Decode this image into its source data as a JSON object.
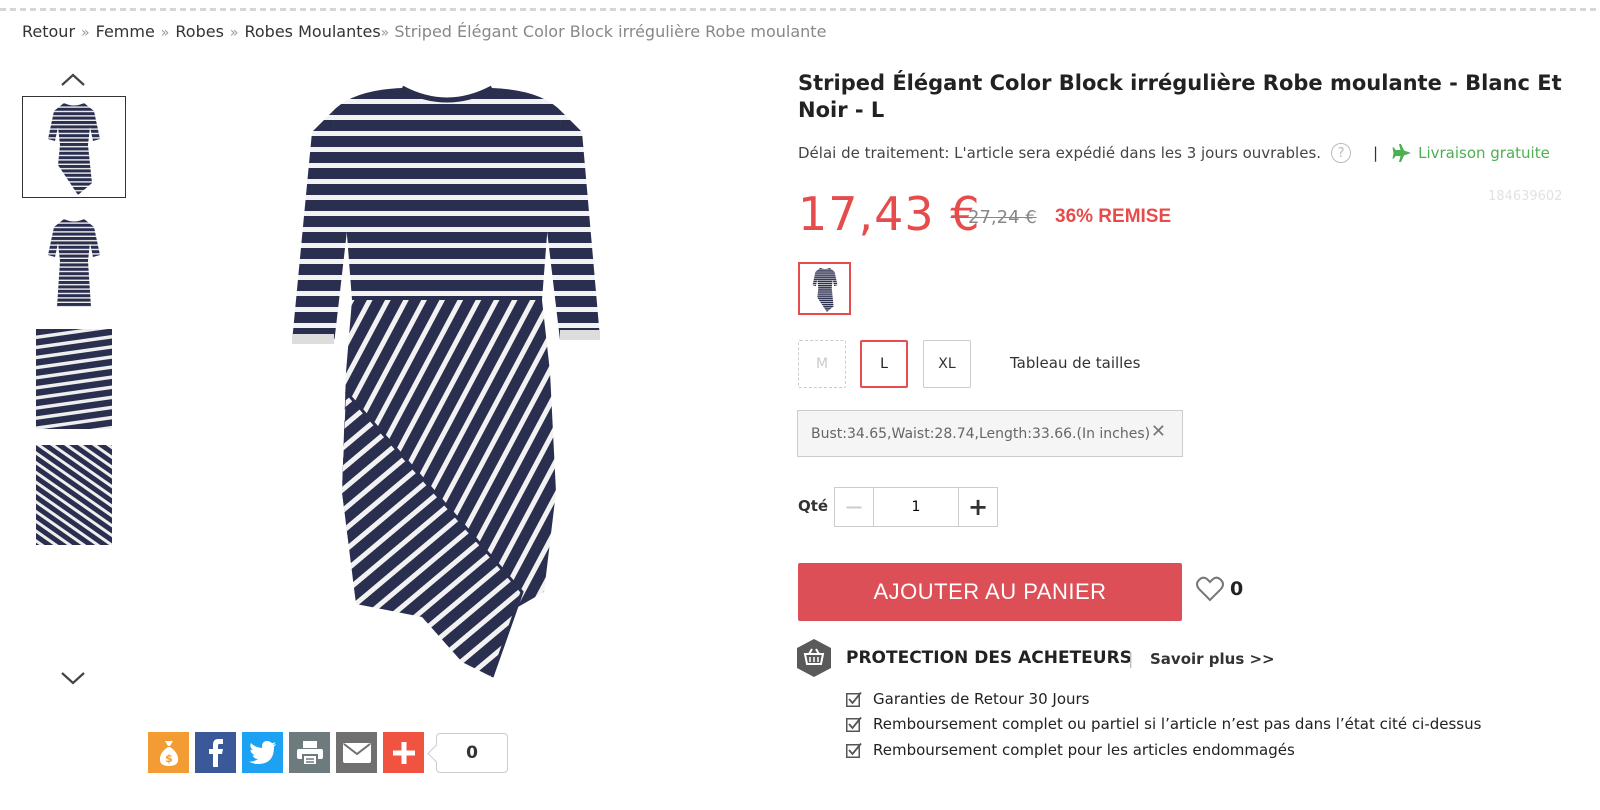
{
  "breadcrumb": {
    "items": [
      "Retour",
      "Femme",
      "Robes",
      "Robes Moulantes"
    ],
    "current": "Striped Élégant Color Block irrégulière Robe moulante"
  },
  "product": {
    "title": "Striped Élégant Color Block irrégulière Robe moulante - Blanc Et Noir - L",
    "delay_text": "Délai de traitement: L'article sera expédié dans les 3 jours ouvrables.",
    "help_glyph": "?",
    "divider": "|",
    "shipping": "Livraison gratuite",
    "sku": "184639602",
    "price": "17,43 €",
    "old_price": "27,24 €",
    "discount": "36% REMISE"
  },
  "sizes": {
    "options": [
      "M",
      "L",
      "XL"
    ],
    "selected": "L",
    "unavailable": [
      "M"
    ],
    "chart_label": "Tableau de tailles",
    "measure": "Bust:34.65,Waist:28.74,Length:33.66.(In inches)",
    "close_glyph": "✕"
  },
  "quantity": {
    "label": "Qté",
    "value": "1",
    "minus": "−",
    "plus": "+"
  },
  "cart": {
    "add_label": "AJOUTER AU PANIER",
    "wish_count": "0"
  },
  "protection": {
    "title": "PROTECTION DES ACHETEURS",
    "sep": "|",
    "more": "Savoir plus >>",
    "items": [
      "Garanties de Retour 30 Jours",
      "Remboursement complet ou partiel si l’article n’est pas dans l’état cité ci-dessus",
      "Remboursement complet pour les articles endommagés"
    ]
  },
  "share": {
    "count": "0"
  },
  "colors": {
    "accent": "#e64c4c",
    "cart": "#dd4f57",
    "shipping": "#4caf50",
    "navy": "#2b2f4f",
    "facebook": "#3b5998",
    "twitter": "#1da1f2",
    "print": "#6d7b7e",
    "email": "#707070",
    "more": "#f0533f",
    "money": "#f39c33"
  }
}
